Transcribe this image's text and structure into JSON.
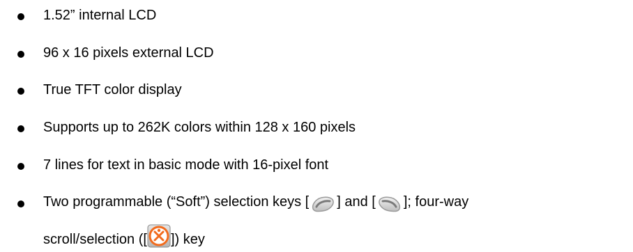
{
  "features": [
    {
      "text": "1.52” internal LCD"
    },
    {
      "text": "96 x 16 pixels external LCD"
    },
    {
      "text": "True TFT color display"
    },
    {
      "text": "Supports up to 262K colors within 128 x 160 pixels"
    },
    {
      "text": "7 lines for text in basic mode with 16-pixel font"
    },
    {
      "part1": "Two programmable (“Soft”) selection keys [",
      "part2": "] and [",
      "part3": "]; four-way",
      "part4": "scroll/selection ([",
      "part5": "]) key",
      "icons": {
        "left_soft_key": "left-soft-key-icon",
        "right_soft_key": "right-soft-key-icon",
        "nav_key": "navigation-key-icon"
      }
    }
  ],
  "colors": {
    "text": "#000000",
    "bullet": "#000000",
    "soft_key_body": "#d9d9d9",
    "soft_key_outline": "#9a9a9a",
    "nav_key_orange": "#f26b1d",
    "nav_key_center": "#ffffff"
  }
}
